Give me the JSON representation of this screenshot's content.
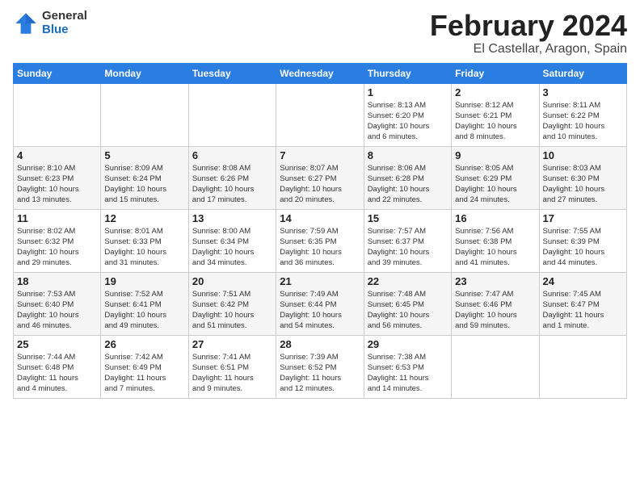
{
  "logo": {
    "general": "General",
    "blue": "Blue"
  },
  "title": "February 2024",
  "subtitle": "El Castellar, Aragon, Spain",
  "days_of_week": [
    "Sunday",
    "Monday",
    "Tuesday",
    "Wednesday",
    "Thursday",
    "Friday",
    "Saturday"
  ],
  "weeks": [
    [
      {
        "day": "",
        "info": ""
      },
      {
        "day": "",
        "info": ""
      },
      {
        "day": "",
        "info": ""
      },
      {
        "day": "",
        "info": ""
      },
      {
        "day": "1",
        "info": "Sunrise: 8:13 AM\nSunset: 6:20 PM\nDaylight: 10 hours\nand 6 minutes."
      },
      {
        "day": "2",
        "info": "Sunrise: 8:12 AM\nSunset: 6:21 PM\nDaylight: 10 hours\nand 8 minutes."
      },
      {
        "day": "3",
        "info": "Sunrise: 8:11 AM\nSunset: 6:22 PM\nDaylight: 10 hours\nand 10 minutes."
      }
    ],
    [
      {
        "day": "4",
        "info": "Sunrise: 8:10 AM\nSunset: 6:23 PM\nDaylight: 10 hours\nand 13 minutes."
      },
      {
        "day": "5",
        "info": "Sunrise: 8:09 AM\nSunset: 6:24 PM\nDaylight: 10 hours\nand 15 minutes."
      },
      {
        "day": "6",
        "info": "Sunrise: 8:08 AM\nSunset: 6:26 PM\nDaylight: 10 hours\nand 17 minutes."
      },
      {
        "day": "7",
        "info": "Sunrise: 8:07 AM\nSunset: 6:27 PM\nDaylight: 10 hours\nand 20 minutes."
      },
      {
        "day": "8",
        "info": "Sunrise: 8:06 AM\nSunset: 6:28 PM\nDaylight: 10 hours\nand 22 minutes."
      },
      {
        "day": "9",
        "info": "Sunrise: 8:05 AM\nSunset: 6:29 PM\nDaylight: 10 hours\nand 24 minutes."
      },
      {
        "day": "10",
        "info": "Sunrise: 8:03 AM\nSunset: 6:30 PM\nDaylight: 10 hours\nand 27 minutes."
      }
    ],
    [
      {
        "day": "11",
        "info": "Sunrise: 8:02 AM\nSunset: 6:32 PM\nDaylight: 10 hours\nand 29 minutes."
      },
      {
        "day": "12",
        "info": "Sunrise: 8:01 AM\nSunset: 6:33 PM\nDaylight: 10 hours\nand 31 minutes."
      },
      {
        "day": "13",
        "info": "Sunrise: 8:00 AM\nSunset: 6:34 PM\nDaylight: 10 hours\nand 34 minutes."
      },
      {
        "day": "14",
        "info": "Sunrise: 7:59 AM\nSunset: 6:35 PM\nDaylight: 10 hours\nand 36 minutes."
      },
      {
        "day": "15",
        "info": "Sunrise: 7:57 AM\nSunset: 6:37 PM\nDaylight: 10 hours\nand 39 minutes."
      },
      {
        "day": "16",
        "info": "Sunrise: 7:56 AM\nSunset: 6:38 PM\nDaylight: 10 hours\nand 41 minutes."
      },
      {
        "day": "17",
        "info": "Sunrise: 7:55 AM\nSunset: 6:39 PM\nDaylight: 10 hours\nand 44 minutes."
      }
    ],
    [
      {
        "day": "18",
        "info": "Sunrise: 7:53 AM\nSunset: 6:40 PM\nDaylight: 10 hours\nand 46 minutes."
      },
      {
        "day": "19",
        "info": "Sunrise: 7:52 AM\nSunset: 6:41 PM\nDaylight: 10 hours\nand 49 minutes."
      },
      {
        "day": "20",
        "info": "Sunrise: 7:51 AM\nSunset: 6:42 PM\nDaylight: 10 hours\nand 51 minutes."
      },
      {
        "day": "21",
        "info": "Sunrise: 7:49 AM\nSunset: 6:44 PM\nDaylight: 10 hours\nand 54 minutes."
      },
      {
        "day": "22",
        "info": "Sunrise: 7:48 AM\nSunset: 6:45 PM\nDaylight: 10 hours\nand 56 minutes."
      },
      {
        "day": "23",
        "info": "Sunrise: 7:47 AM\nSunset: 6:46 PM\nDaylight: 10 hours\nand 59 minutes."
      },
      {
        "day": "24",
        "info": "Sunrise: 7:45 AM\nSunset: 6:47 PM\nDaylight: 11 hours\nand 1 minute."
      }
    ],
    [
      {
        "day": "25",
        "info": "Sunrise: 7:44 AM\nSunset: 6:48 PM\nDaylight: 11 hours\nand 4 minutes."
      },
      {
        "day": "26",
        "info": "Sunrise: 7:42 AM\nSunset: 6:49 PM\nDaylight: 11 hours\nand 7 minutes."
      },
      {
        "day": "27",
        "info": "Sunrise: 7:41 AM\nSunset: 6:51 PM\nDaylight: 11 hours\nand 9 minutes."
      },
      {
        "day": "28",
        "info": "Sunrise: 7:39 AM\nSunset: 6:52 PM\nDaylight: 11 hours\nand 12 minutes."
      },
      {
        "day": "29",
        "info": "Sunrise: 7:38 AM\nSunset: 6:53 PM\nDaylight: 11 hours\nand 14 minutes."
      },
      {
        "day": "",
        "info": ""
      },
      {
        "day": "",
        "info": ""
      }
    ]
  ]
}
